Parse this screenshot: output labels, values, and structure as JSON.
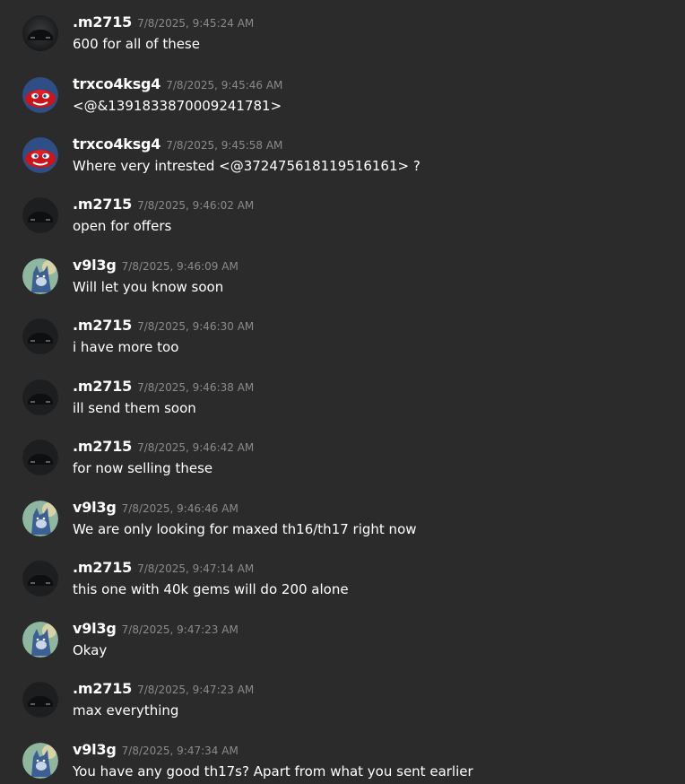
{
  "messages": [
    {
      "author": ".m2715",
      "avatar": "car-avatar",
      "timestamp": "7/8/2025, 9:45:24 AM",
      "text": "600 for all of these"
    },
    {
      "author": "trxco4ksg4",
      "avatar": "red-car-cartoon-avatar",
      "timestamp": "7/8/2025, 9:45:46 AM",
      "text": "<@&1391833870009241781>"
    },
    {
      "author": "trxco4ksg4",
      "avatar": "red-car-cartoon-avatar",
      "timestamp": "7/8/2025, 9:45:58 AM",
      "text": "Where very intrested <@372475618119516161> ?"
    },
    {
      "author": ".m2715",
      "avatar": "car-avatar",
      "timestamp": "7/8/2025, 9:46:02 AM",
      "text": "open for offers"
    },
    {
      "author": "v9l3g",
      "avatar": "wolf-avatar",
      "timestamp": "7/8/2025, 9:46:09 AM",
      "text": "Will let you know soon"
    },
    {
      "author": ".m2715",
      "avatar": "car-avatar",
      "timestamp": "7/8/2025, 9:46:30 AM",
      "text": "i have more too"
    },
    {
      "author": ".m2715",
      "avatar": "car-avatar",
      "timestamp": "7/8/2025, 9:46:38 AM",
      "text": "ill send them soon"
    },
    {
      "author": ".m2715",
      "avatar": "car-avatar",
      "timestamp": "7/8/2025, 9:46:42 AM",
      "text": "for now selling these"
    },
    {
      "author": "v9l3g",
      "avatar": "wolf-avatar",
      "timestamp": "7/8/2025, 9:46:46 AM",
      "text": "We are only looking for maxed th16/th17 right now"
    },
    {
      "author": ".m2715",
      "avatar": "car-avatar",
      "timestamp": "7/8/2025, 9:47:14 AM",
      "text": "this one with 40k gems will do 200 alone"
    },
    {
      "author": "v9l3g",
      "avatar": "wolf-avatar",
      "timestamp": "7/8/2025, 9:47:23 AM",
      "text": "Okay"
    },
    {
      "author": ".m2715",
      "avatar": "car-avatar",
      "timestamp": "7/8/2025, 9:47:23 AM",
      "text": "max everything"
    },
    {
      "author": "v9l3g",
      "avatar": "wolf-avatar",
      "timestamp": "7/8/2025, 9:47:34 AM",
      "text": "You have any good th17s? Apart from what you sent earlier"
    }
  ]
}
